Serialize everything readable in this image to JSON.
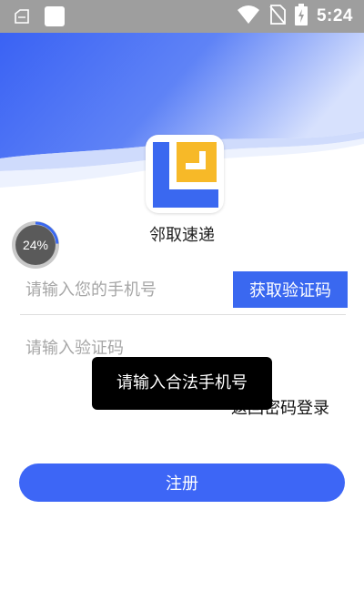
{
  "status_bar": {
    "time": "5:24",
    "icons": [
      "launcher-icon",
      "notification-square-icon",
      "wifi-icon",
      "no-sim-icon",
      "battery-charging-icon"
    ]
  },
  "app": {
    "name": "邻取速递",
    "logo_icon": "app-logo-icon",
    "colors": {
      "brand_blue": "#3a68f0",
      "logo_yellow": "#f7b928"
    }
  },
  "progress": {
    "value": 0.24,
    "label": "24%"
  },
  "form": {
    "phone_placeholder": "请输入您的手机号",
    "get_code_label": "获取验证码",
    "code_placeholder": "请输入验证码",
    "back_login_label": "返回密码登录",
    "register_label": "注册"
  },
  "toast": {
    "message": "请输入合法手机号"
  }
}
